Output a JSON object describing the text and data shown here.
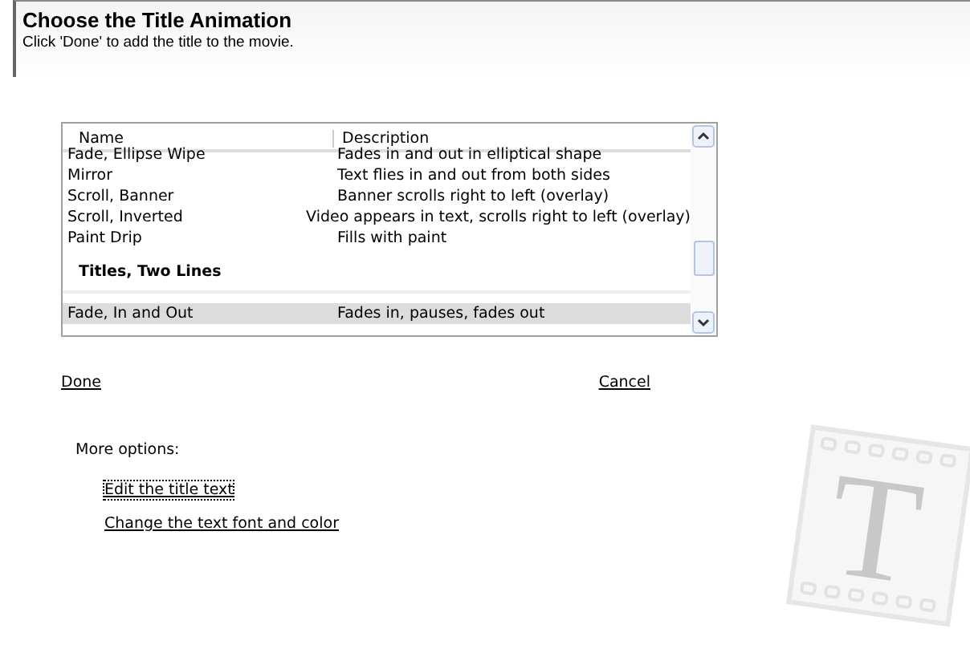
{
  "header": {
    "title": "Choose the Title Animation",
    "subtitle": "Click 'Done' to add the title to the movie."
  },
  "list": {
    "columns": [
      "Name",
      "Description"
    ],
    "rows": [
      {
        "kind": "item",
        "name": "Fade, Ellipse Wipe",
        "description": "Fades in and out in elliptical shape",
        "selected": false
      },
      {
        "kind": "item",
        "name": "Mirror",
        "description": "Text flies in and out from both sides",
        "selected": false
      },
      {
        "kind": "item",
        "name": "Scroll, Banner",
        "description": "Banner scrolls right to left (overlay)",
        "selected": false
      },
      {
        "kind": "item",
        "name": "Scroll, Inverted",
        "description": "Video appears in text, scrolls right to left (overlay)",
        "selected": false
      },
      {
        "kind": "item",
        "name": "Paint Drip",
        "description": "Fills with paint",
        "selected": false
      },
      {
        "kind": "group",
        "name": "Titles, Two Lines"
      },
      {
        "kind": "item",
        "name": "Fade, In and Out",
        "description": "Fades in, pauses, fades out",
        "selected": true
      }
    ]
  },
  "actions": {
    "done": "Done",
    "cancel": "Cancel"
  },
  "more_options": {
    "label": "More options:",
    "links": [
      "Edit the title text",
      "Change the text font and color"
    ]
  },
  "decoration": {
    "letter": "T"
  }
}
